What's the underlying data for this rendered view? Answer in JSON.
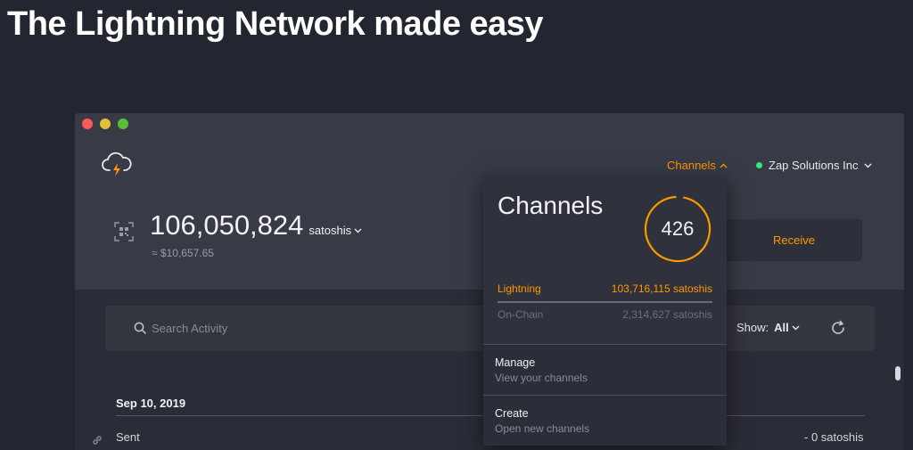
{
  "headline": "The Lightning Network made easy",
  "colors": {
    "accent": "#fd9800",
    "online": "#39e673",
    "background": "#232530",
    "header": "#383a46"
  },
  "app": {
    "logo_icon": "cloud-lightning-icon",
    "nav": {
      "channels_label": "Channels",
      "wallet_name": "Zap Solutions Inc"
    },
    "balance": {
      "amount": "106,050,824",
      "unit": "satoshis",
      "fiat": "≈ $10,657.65"
    },
    "receive_label": "Receive"
  },
  "activity": {
    "search_placeholder": "Search Activity",
    "show_label": "Show:",
    "show_value": "All",
    "date": "Sep 10, 2019",
    "transactions": [
      {
        "type": "Sent",
        "amount": "- 0 satoshis"
      }
    ]
  },
  "channels_dropdown": {
    "title": "Channels",
    "count": "426",
    "lightning_label": "Lightning",
    "lightning_value": "103,716,115 satoshis",
    "onchain_label": "On-Chain",
    "onchain_value": "2,314,627 satoshis",
    "menu": [
      {
        "title": "Manage",
        "subtitle": "View your channels"
      },
      {
        "title": "Create",
        "subtitle": "Open new channels"
      }
    ]
  }
}
